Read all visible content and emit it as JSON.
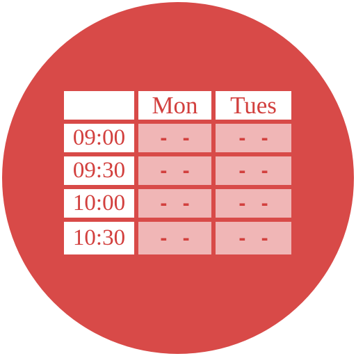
{
  "icon": {
    "name": "schedule-timetable-icon",
    "background_shape": "circle",
    "colors": {
      "circle_background": "#d84a48",
      "header_cell_background": "#ffffff",
      "time_cell_background": "#ffffff",
      "slot_cell_background": "#f0b6b6",
      "text": "#d2403e"
    }
  },
  "table": {
    "corner_label": "",
    "day_columns": [
      {
        "label": "Mon"
      },
      {
        "label": "Tues"
      }
    ],
    "rows": [
      {
        "time": "09:00",
        "slots": [
          "- -",
          "- -"
        ]
      },
      {
        "time": "09:30",
        "slots": [
          "- -",
          "- -"
        ]
      },
      {
        "time": "10:00",
        "slots": [
          "- -",
          "- -"
        ]
      },
      {
        "time": "10:30",
        "slots": [
          "- -",
          "- -"
        ]
      }
    ]
  }
}
